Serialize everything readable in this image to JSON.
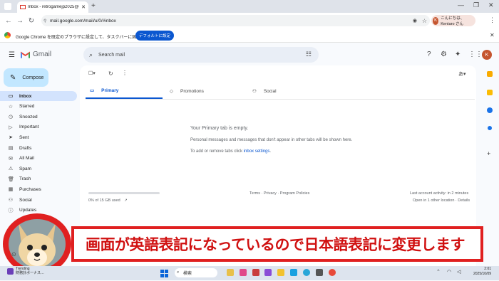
{
  "browser": {
    "tab_title": "Inbox - retrogamejp2025@gm...",
    "new_tab": "+",
    "url": "mail.google.com/mail/u/0/#inbox",
    "profile_name": "こんにちは、Kentaro さん",
    "profile_initial": "K",
    "infobar_message": "Google Chrome を既定のブラウザに設定して、タスクバーに固定する",
    "infobar_button": "デフォルトに設定"
  },
  "gmail": {
    "app_name": "Gmail",
    "search_placeholder": "Search mail",
    "avatar_initial": "K",
    "compose_label": "Compose",
    "lang_indicator": "あ",
    "nav": [
      {
        "label": "Inbox",
        "icon": "inbox-icon",
        "active": true
      },
      {
        "label": "Starred",
        "icon": "star-icon"
      },
      {
        "label": "Snoozed",
        "icon": "clock-icon"
      },
      {
        "label": "Important",
        "icon": "important-icon"
      },
      {
        "label": "Sent",
        "icon": "send-icon"
      },
      {
        "label": "Drafts",
        "icon": "draft-icon"
      },
      {
        "label": "All Mail",
        "icon": "all-mail-icon"
      },
      {
        "label": "Spam",
        "icon": "spam-icon"
      },
      {
        "label": "Trash",
        "icon": "trash-icon"
      },
      {
        "label": "Purchases",
        "icon": "purchases-icon"
      },
      {
        "label": "Social",
        "icon": "social-icon"
      },
      {
        "label": "Updates",
        "icon": "info-icon"
      }
    ],
    "tabs": [
      {
        "label": "Primary",
        "icon": "inbox-icon"
      },
      {
        "label": "Promotions",
        "icon": "tag-icon"
      },
      {
        "label": "Social",
        "icon": "people-icon"
      }
    ],
    "empty_title": "Your Primary tab is empty.",
    "empty_desc": "Personal messages and messages that don't appear in other tabs will be shown here.",
    "empty_hint_prefix": "To add or remove tabs click ",
    "empty_hint_link": "inbox settings",
    "empty_hint_suffix": ".",
    "storage_text": "0% of 15 GB used",
    "storage_fraction": 0.0,
    "footer_terms": "Terms",
    "footer_privacy": "Privacy",
    "footer_policies": "Program Policies",
    "footer_sep": " · ",
    "activity_line1": "Last account activity: in 2 minutes",
    "activity_line2": "Open in 1 other location",
    "activity_details": "Details"
  },
  "banner": {
    "text": "画面が英語表記になっているので日本語表記に変更します"
  },
  "taskbar": {
    "news_title": "Trending",
    "news_sub": "財務計ボーナス…",
    "search_placeholder": "検索",
    "time": "2:01",
    "date": "2025/10/09"
  }
}
